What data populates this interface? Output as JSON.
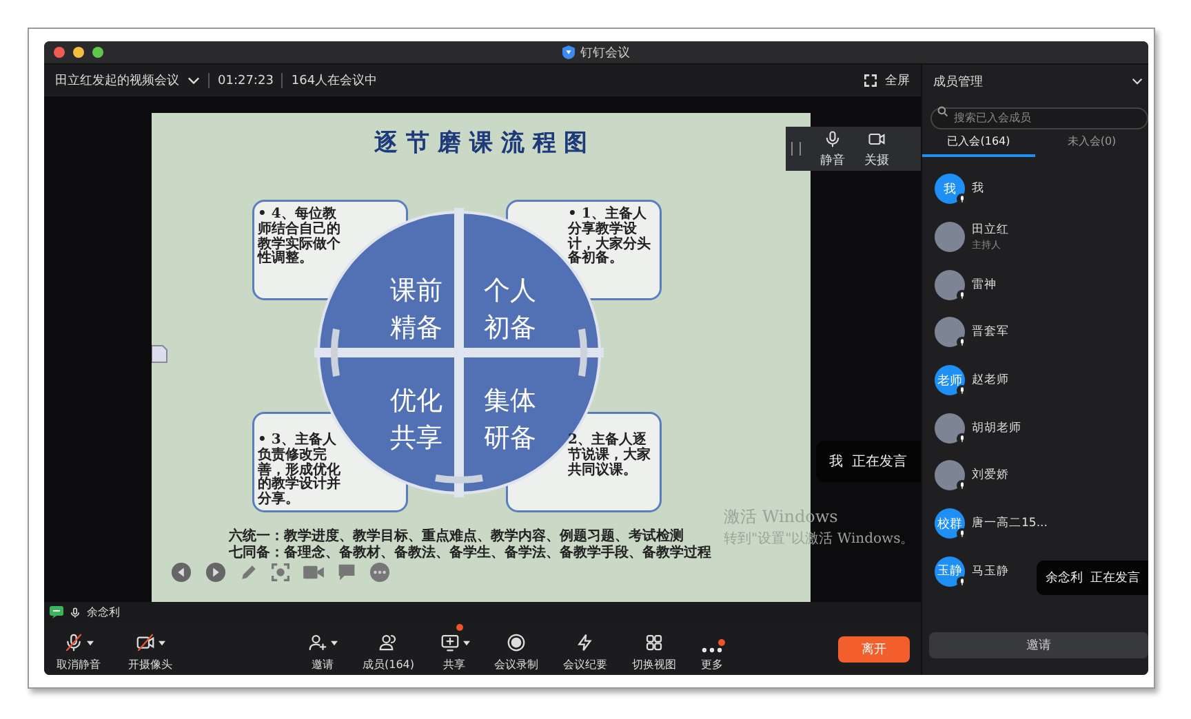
{
  "window": {
    "title": "钉钉会议"
  },
  "header": {
    "meeting_title": "田立红发起的视频会议",
    "duration": "01:27:23",
    "attendance": "164人在会议中",
    "fullscreen": "全屏"
  },
  "slide": {
    "title": "逐 节 磨 课 流 程 图",
    "quadrants": [
      "课前精备",
      "个人初备",
      "优化共享",
      "集体研备"
    ],
    "notes": [
      "• 4、每位教师结合自己的教学实际做个性调整。",
      "• 1、主备人分享教学设计，大家分头备初备。",
      "• 3、主备人负责修改完善，形成优化的教学设计并分享。",
      "2、主备人逐节说课，大家共同议课。"
    ],
    "footer": [
      "六统一：教学进度、教学目标、重点难点、教学内容、例题习题、考试检测",
      "七同备：备理念、备教材、备教法、备学生、备学法、备教学手段、备教学过程"
    ]
  },
  "os_notice": {
    "title": "激活 Windows",
    "hint": "转到\"设置\"以激活 Windows。"
  },
  "floating_controls": [
    {
      "kind": "mic",
      "label": "静音"
    },
    {
      "kind": "camera",
      "label": "关摄"
    }
  ],
  "speaking_toast": "我  正在发言",
  "active_speaker": "余念利",
  "toolbar": [
    {
      "kind": "mic_off",
      "label": "取消静音",
      "has_menu": true,
      "badge": false
    },
    {
      "kind": "camera_off",
      "label": "开摄像头",
      "has_menu": true,
      "badge": false
    },
    {
      "kind": "invite",
      "label": "邀请",
      "has_menu": true,
      "badge": false
    },
    {
      "kind": "members",
      "label": "成员(164)",
      "has_menu": false,
      "badge": false
    },
    {
      "kind": "share",
      "label": "共享",
      "has_menu": true,
      "badge": true
    },
    {
      "kind": "record",
      "label": "会议录制",
      "has_menu": false,
      "badge": false
    },
    {
      "kind": "notes",
      "label": "会议纪要",
      "has_menu": false,
      "badge": false
    },
    {
      "kind": "layout",
      "label": "切换视图",
      "has_menu": false,
      "badge": false
    },
    {
      "kind": "more",
      "label": "更多",
      "has_menu": false,
      "badge": true
    }
  ],
  "leave_button": "离开",
  "panel": {
    "title": "成员管理",
    "search": {
      "placeholder": "搜索已入会成员"
    },
    "tabs": [
      {
        "label": "已入会(164)",
        "selected": true
      },
      {
        "label": "未入会(0)",
        "selected": false
      }
    ],
    "members": [
      {
        "name": "我",
        "avatar": {
          "kind": "text",
          "text": "我"
        },
        "mic": true
      },
      {
        "name": "田立红",
        "role": "主持人",
        "avatar": {
          "kind": "photo"
        },
        "mic": false
      },
      {
        "name": "雷神",
        "avatar": {
          "kind": "photo"
        },
        "mic": true
      },
      {
        "name": "晋套军",
        "avatar": {
          "kind": "photo"
        },
        "mic": true
      },
      {
        "name": "赵老师",
        "avatar": {
          "kind": "text",
          "text": "老师"
        },
        "mic": true
      },
      {
        "name": "胡胡老师",
        "avatar": {
          "kind": "photo"
        },
        "mic": true
      },
      {
        "name": "刘爱娇",
        "avatar": {
          "kind": "photo"
        },
        "mic": true
      },
      {
        "name": "唐一高二15...",
        "avatar": {
          "kind": "text",
          "text": "校群"
        },
        "mic": true
      },
      {
        "name": "马玉静",
        "avatar": {
          "kind": "text",
          "text": "玉静"
        },
        "mic": true
      }
    ],
    "speaking_toast": "余念利  正在发言",
    "invite_button": "邀请"
  }
}
